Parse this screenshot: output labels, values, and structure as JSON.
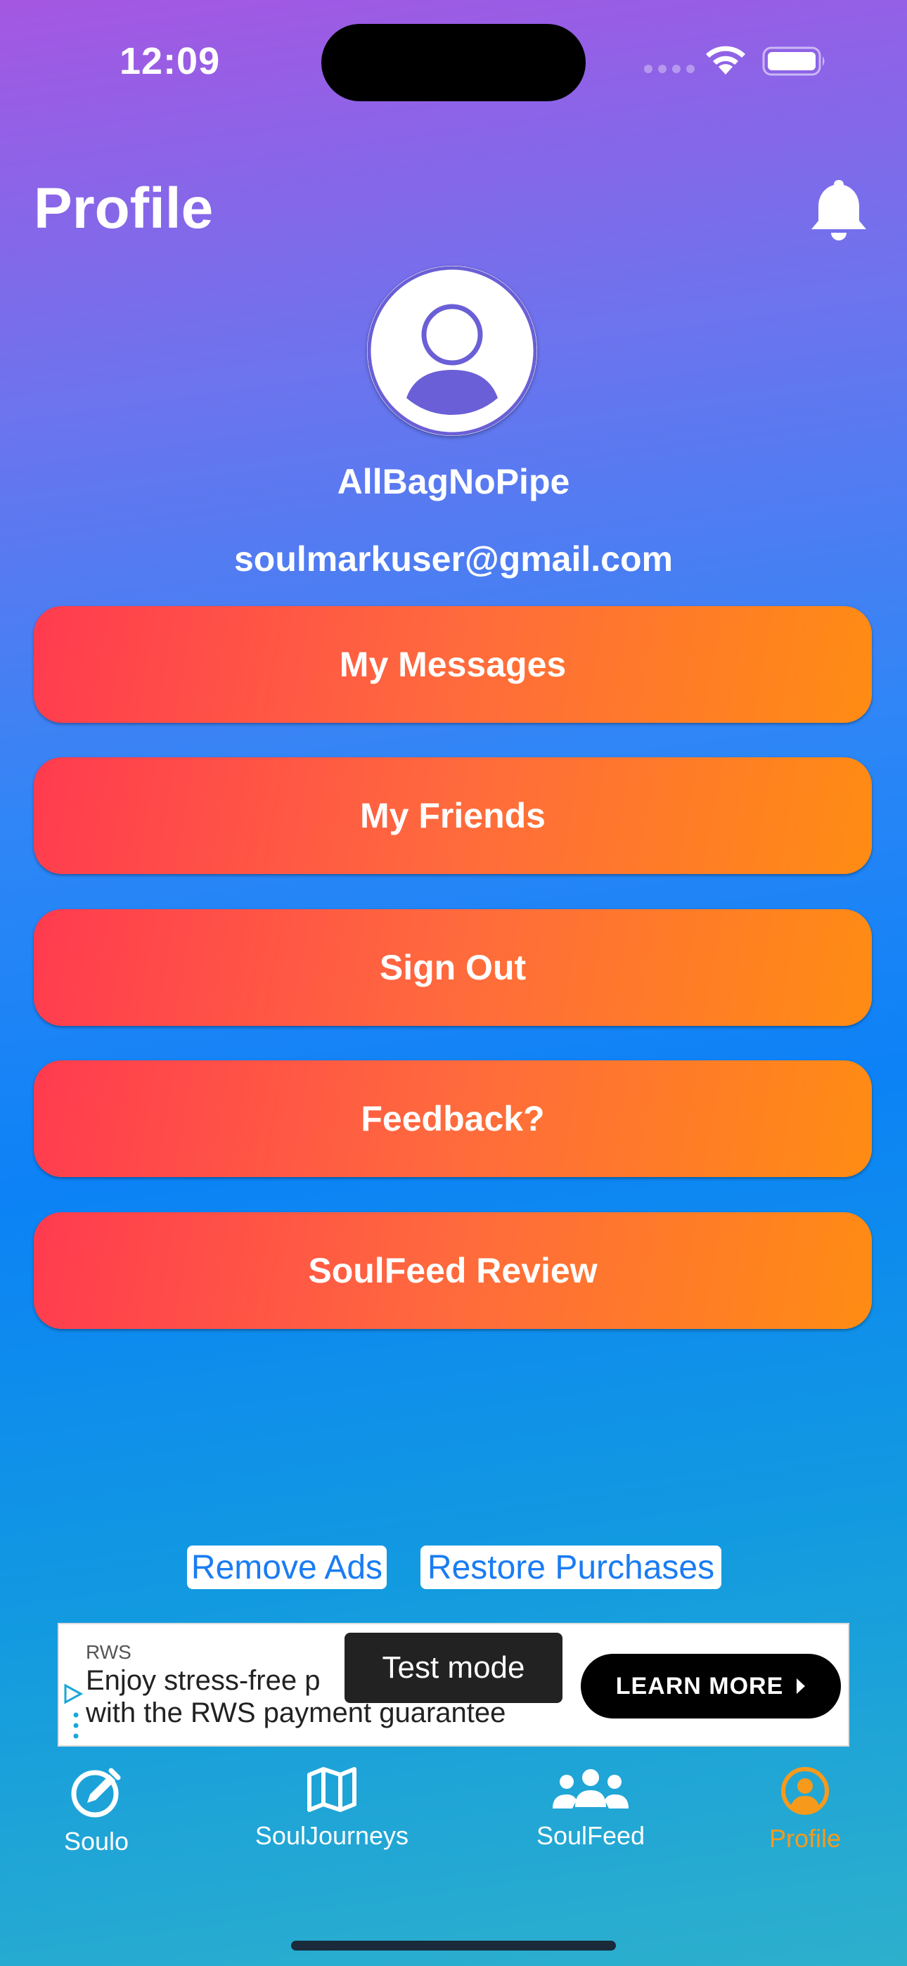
{
  "status_bar": {
    "time": "12:09",
    "icons": [
      "cellular-signal-icon",
      "wifi-icon",
      "battery-icon"
    ]
  },
  "header": {
    "title": "Profile",
    "notification_icon": "bell-icon"
  },
  "profile": {
    "avatar_icon": "person-icon",
    "username": "AllBagNoPipe",
    "email": "soulmarkuser@gmail.com"
  },
  "actions": [
    {
      "label": "My Messages"
    },
    {
      "label": "My Friends"
    },
    {
      "label": "Sign Out"
    },
    {
      "label": "Feedback?"
    },
    {
      "label": "SoulFeed Review"
    }
  ],
  "purchases": {
    "remove_ads": "Remove Ads",
    "restore": "Restore Purchases"
  },
  "ad": {
    "advertiser": "RWS",
    "line1": "Enjoy stress-free p",
    "line2": "with the RWS payment guarantee",
    "cta": "LEARN MORE",
    "test_mode": "Test mode"
  },
  "tabs": [
    {
      "label": "Soulo",
      "icon": "compass-pencil-icon"
    },
    {
      "label": "SoulJourneys",
      "icon": "map-icon"
    },
    {
      "label": "SoulFeed",
      "icon": "people-icon"
    },
    {
      "label": "Profile",
      "icon": "person-circle-icon",
      "active": true
    }
  ],
  "colors": {
    "accent_active_tab": "#f79a1b",
    "button_gradient_start": "#ff3b4f",
    "button_gradient_end": "#ff8c13",
    "link": "#1a7cf2"
  }
}
